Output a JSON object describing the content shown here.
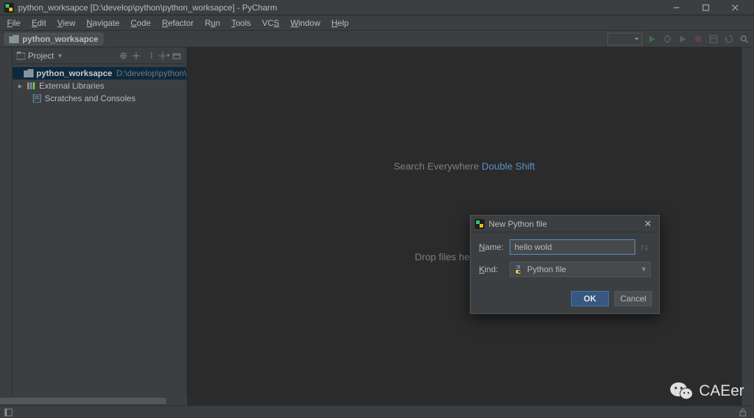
{
  "window": {
    "title": "python_worksapce [D:\\develop\\python\\python_worksapce] - PyCharm"
  },
  "menu": {
    "file": "File",
    "edit": "Edit",
    "view": "View",
    "navigate": "Navigate",
    "code": "Code",
    "refactor": "Refactor",
    "run": "Run",
    "tools": "Tools",
    "vcs": "VCS",
    "window": "Window",
    "help": "Help"
  },
  "breadcrumb": {
    "root": "python_worksapce"
  },
  "project_panel": {
    "title": "Project",
    "tree": {
      "root_name": "python_worksapce",
      "root_path": "D:\\develop\\python\\python_worksapce",
      "external": "External Libraries",
      "scratches": "Scratches and Consoles"
    }
  },
  "editor_hints": {
    "search": "Search Everywhere  ",
    "search_kb": "Double Shift",
    "drop": "Drop files here to open"
  },
  "dialog": {
    "title": "New Python file",
    "name_label": "Name:",
    "name_value": "hello wold",
    "kind_label": "Kind:",
    "kind_value": "Python file",
    "ok": "OK",
    "cancel": "Cancel"
  },
  "watermark": {
    "text": "CAEer"
  }
}
